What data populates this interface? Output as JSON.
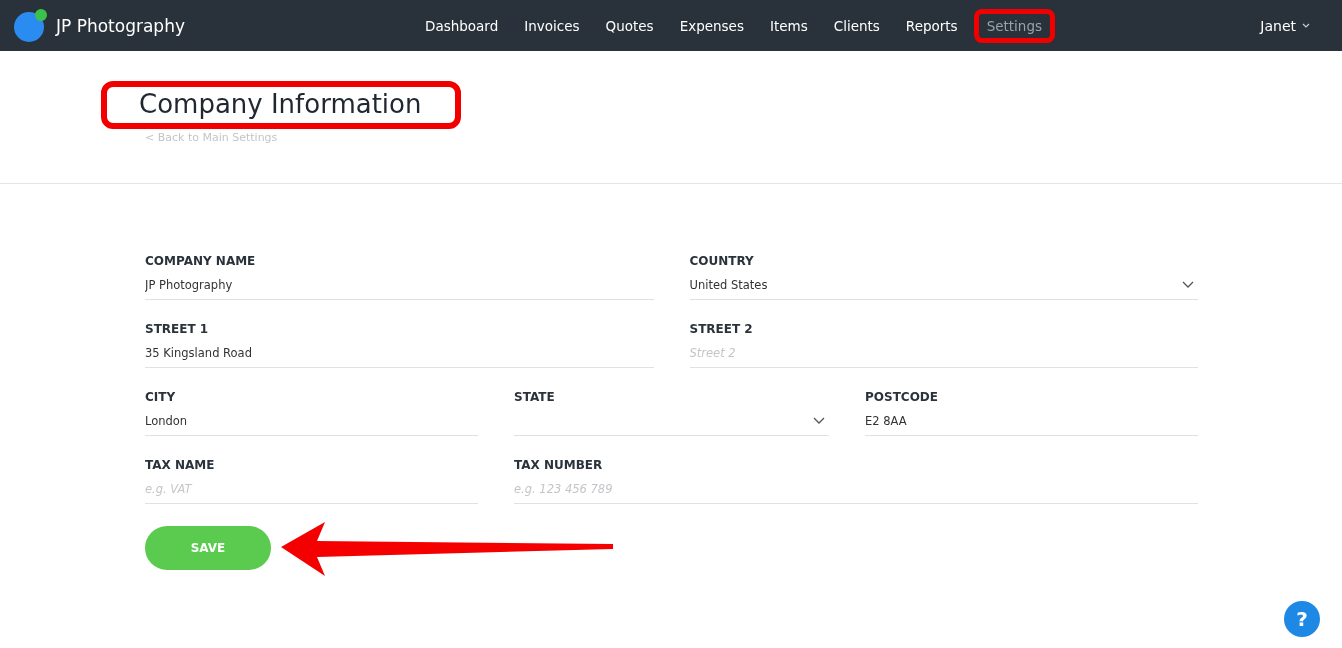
{
  "app": {
    "name": "JP Photography"
  },
  "nav": [
    {
      "label": "Dashboard",
      "selected": false,
      "highlighted": false
    },
    {
      "label": "Invoices",
      "selected": false,
      "highlighted": false
    },
    {
      "label": "Quotes",
      "selected": false,
      "highlighted": false
    },
    {
      "label": "Expenses",
      "selected": false,
      "highlighted": false
    },
    {
      "label": "Items",
      "selected": false,
      "highlighted": false
    },
    {
      "label": "Clients",
      "selected": false,
      "highlighted": false
    },
    {
      "label": "Reports",
      "selected": false,
      "highlighted": false
    },
    {
      "label": "Settings",
      "selected": true,
      "highlighted": true
    }
  ],
  "user": {
    "name": "Janet"
  },
  "header": {
    "title": "Company Information",
    "highlighted": true,
    "back_link": "< Back to Main Settings"
  },
  "form": {
    "rows": [
      [
        {
          "label": "COMPANY NAME",
          "kind": "text",
          "value": "JP Photography"
        },
        {
          "label": "COUNTRY",
          "kind": "select",
          "value": "United States"
        }
      ],
      [
        {
          "label": "STREET 1",
          "kind": "text",
          "value": "35 Kingsland Road"
        },
        {
          "label": "STREET 2",
          "kind": "text",
          "placeholder": "Street 2"
        }
      ],
      [
        {
          "label": "CITY",
          "kind": "text",
          "value": "London"
        },
        {
          "label": "STATE",
          "kind": "select"
        },
        {
          "label": "POSTCODE",
          "kind": "text",
          "value": "E2 8AA"
        }
      ],
      [
        {
          "label": "TAX NAME",
          "kind": "text",
          "placeholder": "e.g. VAT"
        },
        {
          "label": "TAX NUMBER",
          "kind": "text",
          "placeholder": "e.g. 123 456 789"
        }
      ]
    ],
    "save": {
      "label": "SAVE",
      "pointed_at": true
    }
  },
  "help": {
    "label": "?"
  }
}
